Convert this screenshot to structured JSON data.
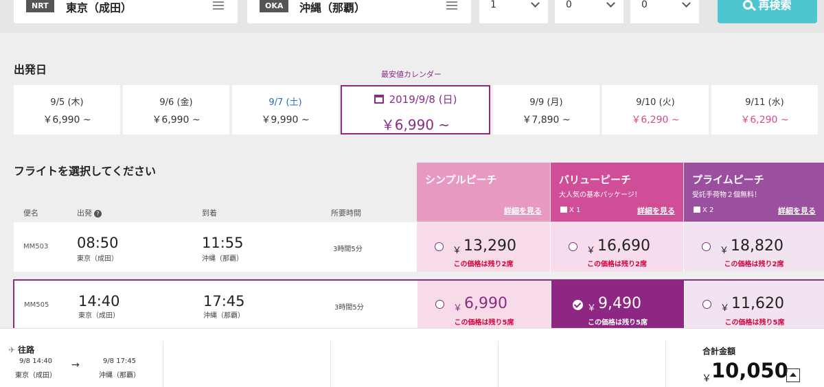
{
  "search": {
    "origin": {
      "code": "NRT",
      "city": "東京（成田）"
    },
    "destination": {
      "code": "OKA",
      "city": "沖縄（那覇）"
    },
    "pax": [
      "1",
      "0",
      "0"
    ],
    "button_label": "再検索"
  },
  "departure": {
    "title": "出発日",
    "calendar_link": "最安値カレンダー",
    "dates": [
      {
        "date": "9/5 (木)",
        "price": "￥6,990 ~"
      },
      {
        "date": "9/6 (金)",
        "price": "￥6,990 ~"
      },
      {
        "date": "9/7 (土)",
        "price": "￥9,990 ~"
      },
      {
        "date": "2019/9/8 (日)",
        "price": "￥6,990 ~"
      },
      {
        "date": "9/9 (月)",
        "price": "￥7,890 ~"
      },
      {
        "date": "9/10 (火)",
        "price": "￥6,290 ~"
      },
      {
        "date": "9/11 (水)",
        "price": "￥6,290 ~"
      }
    ]
  },
  "flights": {
    "title": "フライトを選択してください",
    "columns": {
      "flight_no": "便名",
      "departure": "出発",
      "arrival": "到着",
      "duration": "所要時間"
    },
    "fares": [
      {
        "name": "シンプルピーチ",
        "subtitle": "",
        "bag": "",
        "detail": "詳細を見る"
      },
      {
        "name": "バリューピーチ",
        "subtitle": "大人気の基本パッケージ！",
        "bag": "X 1",
        "detail": "詳細を見る"
      },
      {
        "name": "プライムピーチ",
        "subtitle": "受託手荷物２個無料！",
        "bag": "X 2",
        "detail": "詳細を見る"
      }
    ],
    "rows": [
      {
        "flight_no": "MM503",
        "dep_time": "08:50",
        "dep_airport": "東京（成田）",
        "arr_time": "11:55",
        "arr_airport": "沖縄（那覇）",
        "duration": "3時間5分",
        "prices": [
          {
            "yen": "￥",
            "amount": "13,290",
            "seats": "この価格は残り2席"
          },
          {
            "yen": "￥",
            "amount": "16,690",
            "seats": "この価格は残り2席"
          },
          {
            "yen": "￥",
            "amount": "18,820",
            "seats": "この価格は残り2席"
          }
        ]
      },
      {
        "flight_no": "MM505",
        "dep_time": "14:40",
        "dep_airport": "東京（成田）",
        "arr_time": "17:45",
        "arr_airport": "沖縄（那覇）",
        "duration": "3時間5分",
        "prices": [
          {
            "yen": "￥",
            "amount": "6,990",
            "seats": "この価格は残り5席"
          },
          {
            "yen": "￥",
            "amount": "9,490",
            "seats": "この価格は残り5席"
          },
          {
            "yen": "￥",
            "amount": "11,620",
            "seats": "この価格は残り5席"
          }
        ]
      }
    ]
  },
  "summary": {
    "route_label": "往路",
    "dep": {
      "time": "9/8 14:40",
      "airport": "東京（成田）"
    },
    "arr": {
      "time": "9/8 17:45",
      "airport": "沖縄（那覇）"
    },
    "arrow": "→",
    "total_label": "合計金額",
    "total_yen": "￥",
    "total_amount": "10,050"
  },
  "colors": {
    "brand": "#8a2b84",
    "accent_teal": "#4dc6cf",
    "pink": "#d6498c",
    "warning_red": "#d6003b"
  }
}
